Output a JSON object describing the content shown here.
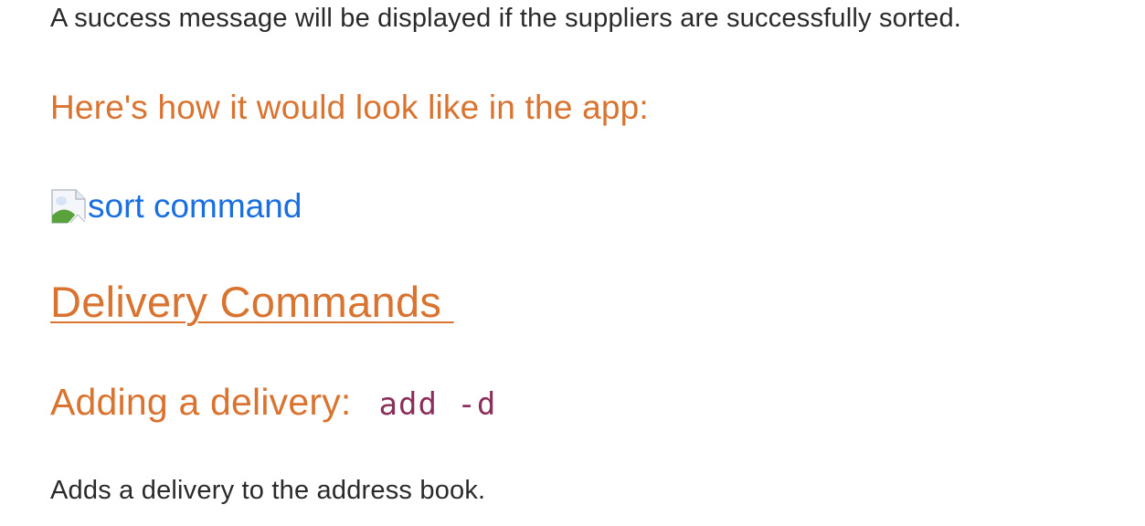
{
  "intro": {
    "success_text": "A success message will be displayed if the suppliers are successfully sorted."
  },
  "look_heading": "Here's how it would look like in the app:",
  "image_link": {
    "alt_text": "sort command",
    "icon": "broken-image-icon"
  },
  "delivery_section": {
    "heading": "Delivery Commands "
  },
  "adding_delivery": {
    "heading": "Adding a delivery:",
    "command": "add -d",
    "description": "Adds a delivery to the address book."
  },
  "colors": {
    "heading": "#d97330",
    "link": "#1a6fe0",
    "code": "#8a2f5a",
    "text": "#2a2a2a"
  }
}
